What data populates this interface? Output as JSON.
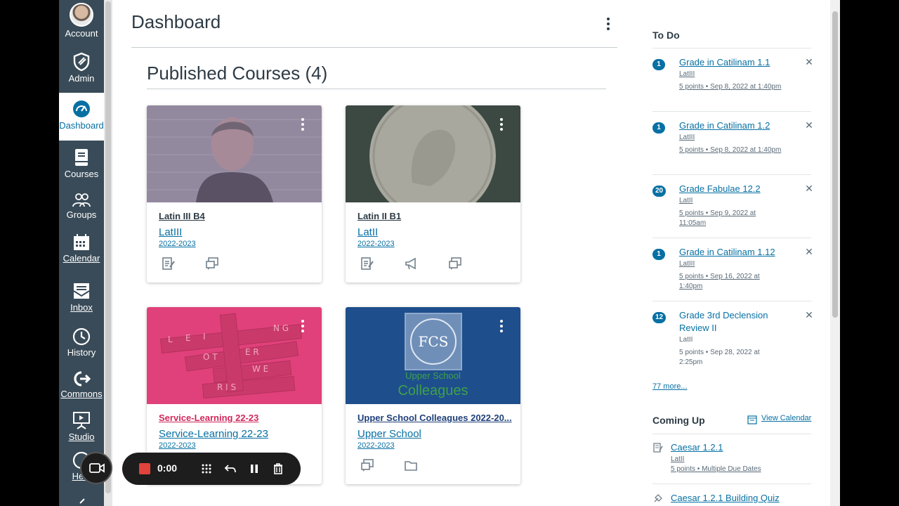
{
  "global_nav": {
    "items": [
      {
        "label": "Account",
        "icon": "avatar"
      },
      {
        "label": "Admin",
        "icon": "shield-icon"
      },
      {
        "label": "Dashboard",
        "icon": "dashboard-icon",
        "active": true
      },
      {
        "label": "Courses",
        "icon": "courses-icon"
      },
      {
        "label": "Groups",
        "icon": "groups-icon"
      },
      {
        "label": "Calendar",
        "icon": "calendar-icon"
      },
      {
        "label": "Inbox",
        "icon": "inbox-icon"
      },
      {
        "label": "History",
        "icon": "history-icon"
      },
      {
        "label": "Commons",
        "icon": "commons-icon"
      },
      {
        "label": "Studio",
        "icon": "studio-icon"
      },
      {
        "label": "Help",
        "icon": "help-icon"
      }
    ]
  },
  "page": {
    "title": "Dashboard",
    "section_title": "Published Courses (4)"
  },
  "cards": [
    {
      "title": "Latin III B4",
      "code": "LatIII",
      "term": "2022-2023",
      "hero_color": "#7a7286",
      "actions": [
        "assignments-icon",
        "discussions-icon"
      ]
    },
    {
      "title": "Latin II B1",
      "code": "LatII",
      "term": "2022-2023",
      "hero_color": "#4c5a53",
      "actions": [
        "assignments-icon",
        "announcements-icon",
        "discussions-icon"
      ]
    },
    {
      "title": "Service-Learning 22-23",
      "code": "Service-Learning 22-23",
      "term": "2022-2023",
      "hero_color": "#e0417a",
      "title_color": "#d0285a",
      "actions": []
    },
    {
      "title": "Upper School Colleagues 2022-20...",
      "code": "Upper School",
      "term": "2022-2023",
      "hero_color": "#1e4f8c",
      "title_color": "#1e3f7a",
      "hero_text": {
        "top": "FCS",
        "mid": "Upper School",
        "bottom": "Colleagues"
      },
      "actions": [
        "discussions-icon",
        "folder-icon"
      ]
    }
  ],
  "todo": {
    "title": "To Do",
    "items": [
      {
        "badge": "1",
        "title": "Grade in Catilinam 1.1",
        "course": "LatIII",
        "meta": "5 points • Sep 8, 2022 at 1:40pm"
      },
      {
        "badge": "1",
        "title": "Grade in Catilinam 1.2",
        "course": "LatIII",
        "meta": "5 points • Sep 8, 2022 at 1:40pm"
      },
      {
        "badge": "20",
        "title": "Grade Fabulae 12.2",
        "course": "LatII",
        "meta": "5 points • Sep 9, 2022 at 11:05am"
      },
      {
        "badge": "1",
        "title": "Grade in Catilinam 1.12",
        "course": "LatIII",
        "meta": "5 points • Sep 16, 2022 at 1:40pm"
      },
      {
        "badge": "12",
        "title": "Grade 3rd Declension Review II",
        "course": "LatII",
        "meta": "5 points • Sep 28, 2022 at 2:25pm"
      }
    ],
    "more": "77 more..."
  },
  "coming_up": {
    "title": "Coming Up",
    "view_calendar": "View Calendar",
    "items": [
      {
        "title": "Caesar 1.2.1",
        "course": "LatII",
        "meta": "5 points • Multiple Due Dates",
        "icon": "assignment-icon"
      },
      {
        "title": "Caesar 1.2.1 Building Quiz",
        "icon": "quiz-icon"
      }
    ]
  },
  "recorder": {
    "time": "0:00"
  },
  "colors": {
    "nav_bg": "#394b58",
    "link": "#0770a3",
    "text": "#2d3b45"
  }
}
